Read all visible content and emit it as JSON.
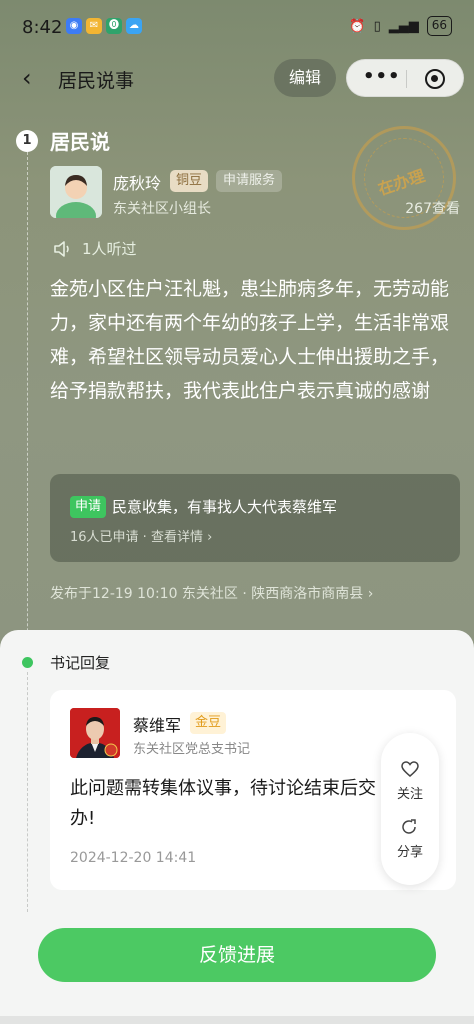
{
  "status_bar": {
    "time": "8:42",
    "battery": "66"
  },
  "nav": {
    "title": "居民说事",
    "edit_label": "编辑"
  },
  "section": {
    "number": "1",
    "title": "居民说"
  },
  "stamp": {
    "text": "在办理"
  },
  "views": "267查看",
  "author": {
    "name": "庞秋玲",
    "badge": "铜豆",
    "service_tag": "申请服务",
    "role": "东关社区小组长"
  },
  "listen": {
    "label": "1人听过"
  },
  "content": "金苑小区住户汪礼魁，患尘肺病多年，无劳动能力，家中还有两个年幼的孩子上学，生活非常艰难，希望社区领导动员爱心人士伸出援助之手，给予捐款帮扶，我代表此住户表示真诚的感谢",
  "apply_card": {
    "tag": "申请",
    "title": "民意收集，有事找人大代表蔡维军",
    "sub": "16人已申请 · 查看详情 ›"
  },
  "meta": "发布于12-19 10:10   东关社区 · 陕西商洛市商南县 ›",
  "reply": {
    "section_title": "书记回复",
    "name": "蔡维军",
    "badge": "金豆",
    "role": "东关社区党总支书记",
    "text": "此问题需转集体议事，待讨论结束后交办!",
    "time": "2024-12-20 14:41"
  },
  "float_actions": {
    "follow": "关注",
    "share": "分享"
  },
  "feedback_button": "反馈进展"
}
